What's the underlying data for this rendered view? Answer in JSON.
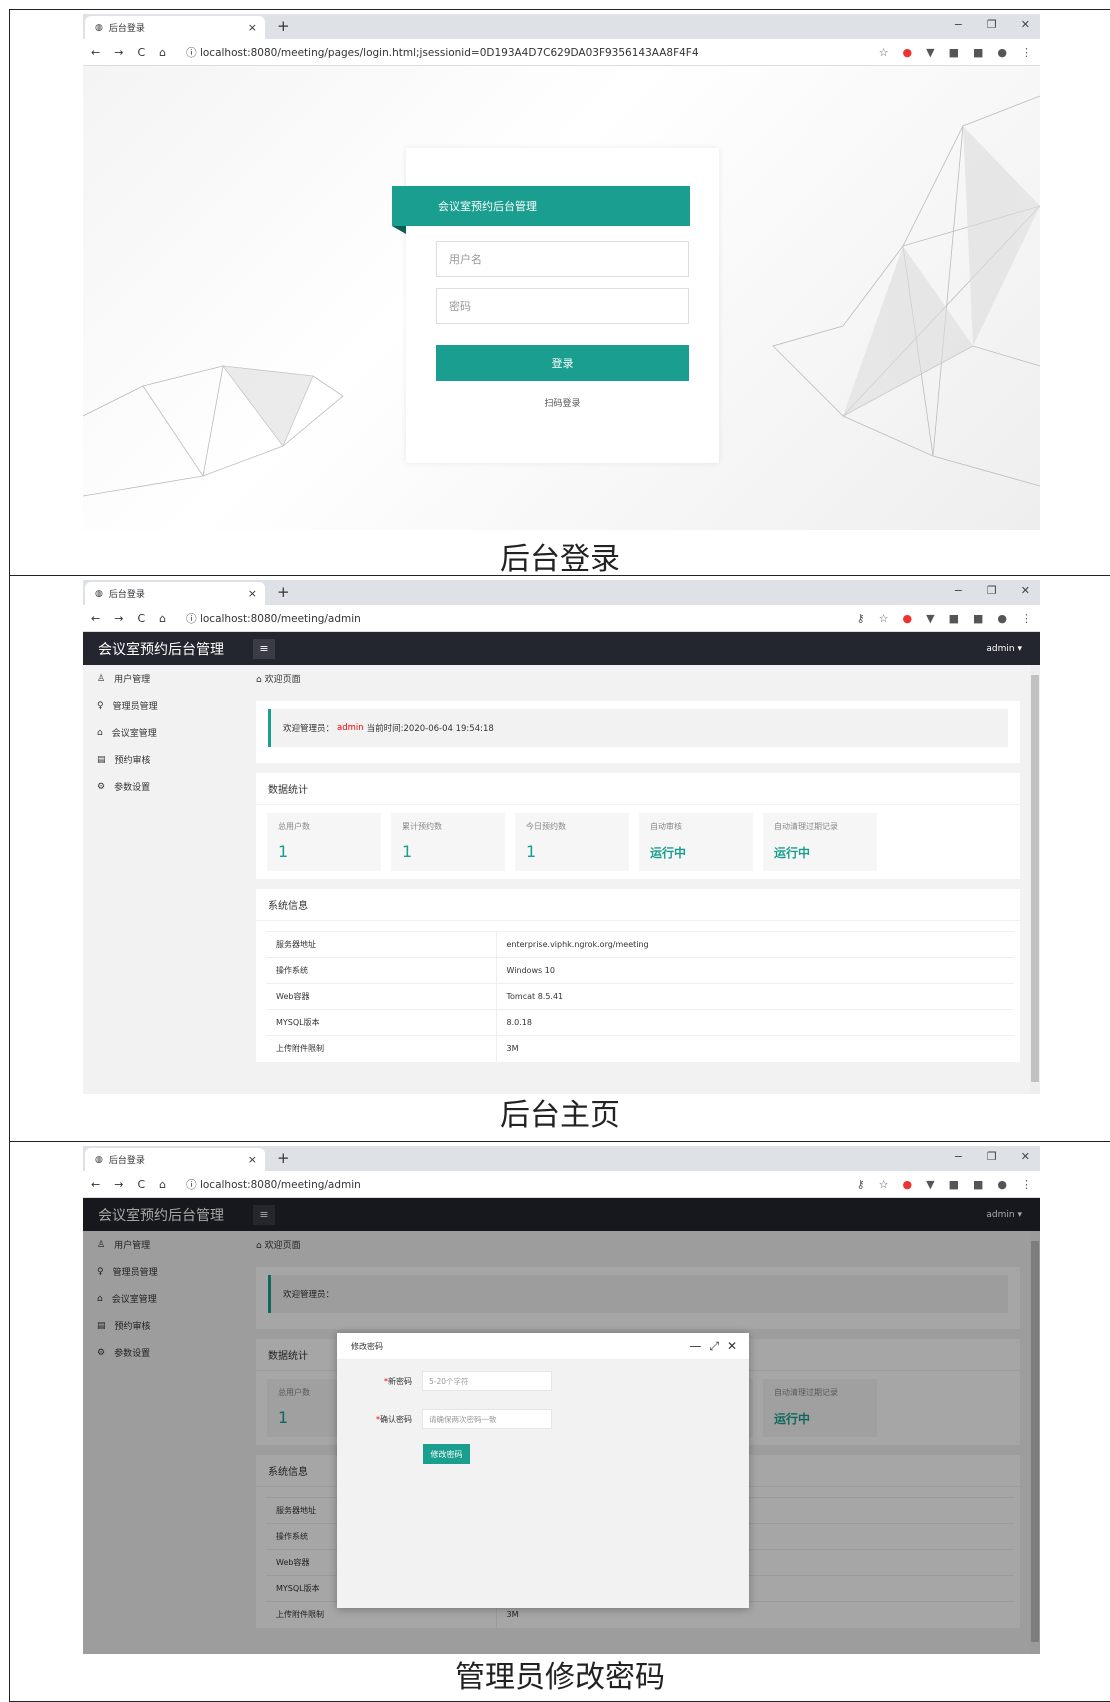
{
  "browser": {
    "tab_title": "后台登录",
    "tab_close": "×",
    "new_tab": "+",
    "win_min": "−",
    "win_max": "❐",
    "win_close": "✕"
  },
  "login": {
    "url": "localhost:8080/meeting/pages/login.html;jsessionid=0D193A4D7C629DA03F9356143AA8F4F4",
    "header": "会议室预约后台管理",
    "username_placeholder": "用户名",
    "password_placeholder": "密码",
    "login_button": "登录",
    "qr_login": "扫码登录",
    "caption": "后台登录"
  },
  "admin": {
    "url": "localhost:8080/meeting/admin",
    "brand": "会议室预约后台管理",
    "user": "admin",
    "sidebar": [
      {
        "label": "用户管理",
        "icon": "user-icon"
      },
      {
        "label": "管理员管理",
        "icon": "bulb-icon"
      },
      {
        "label": "会议室管理",
        "icon": "home-icon"
      },
      {
        "label": "预约审核",
        "icon": "doc-icon"
      },
      {
        "label": "参数设置",
        "icon": "gear-icon"
      }
    ],
    "breadcrumb": "欢迎页面",
    "welcome_prefix": "欢迎管理员：",
    "welcome_user": "admin",
    "welcome_time": "当前时间:2020-06-04 19:54:18",
    "stats_title": "数据统计",
    "stats": [
      {
        "label": "总用户数",
        "value": "1"
      },
      {
        "label": "累计预约数",
        "value": "1"
      },
      {
        "label": "今日预约数",
        "value": "1"
      },
      {
        "label": "自动审核",
        "value": "运行中"
      },
      {
        "label": "自动清理过期记录",
        "value": "运行中"
      }
    ],
    "sysinfo_title": "系统信息",
    "sysinfo": [
      [
        "服务器地址",
        "enterprise.viphk.ngrok.org/meeting"
      ],
      [
        "操作系统",
        "Windows 10"
      ],
      [
        "Web容器",
        "Tomcat 8.5.41"
      ],
      [
        "MYSQL版本",
        "8.0.18"
      ],
      [
        "上传附件限制",
        "3M"
      ]
    ],
    "caption": "后台主页"
  },
  "modal": {
    "title": "修改密码",
    "new_password_label": "新密码",
    "new_password_placeholder": "5-20个字符",
    "confirm_label": "确认密码",
    "confirm_placeholder": "请确保两次密码一致",
    "submit": "修改密码",
    "required_mark": "*",
    "caption": "管理员修改密码"
  }
}
